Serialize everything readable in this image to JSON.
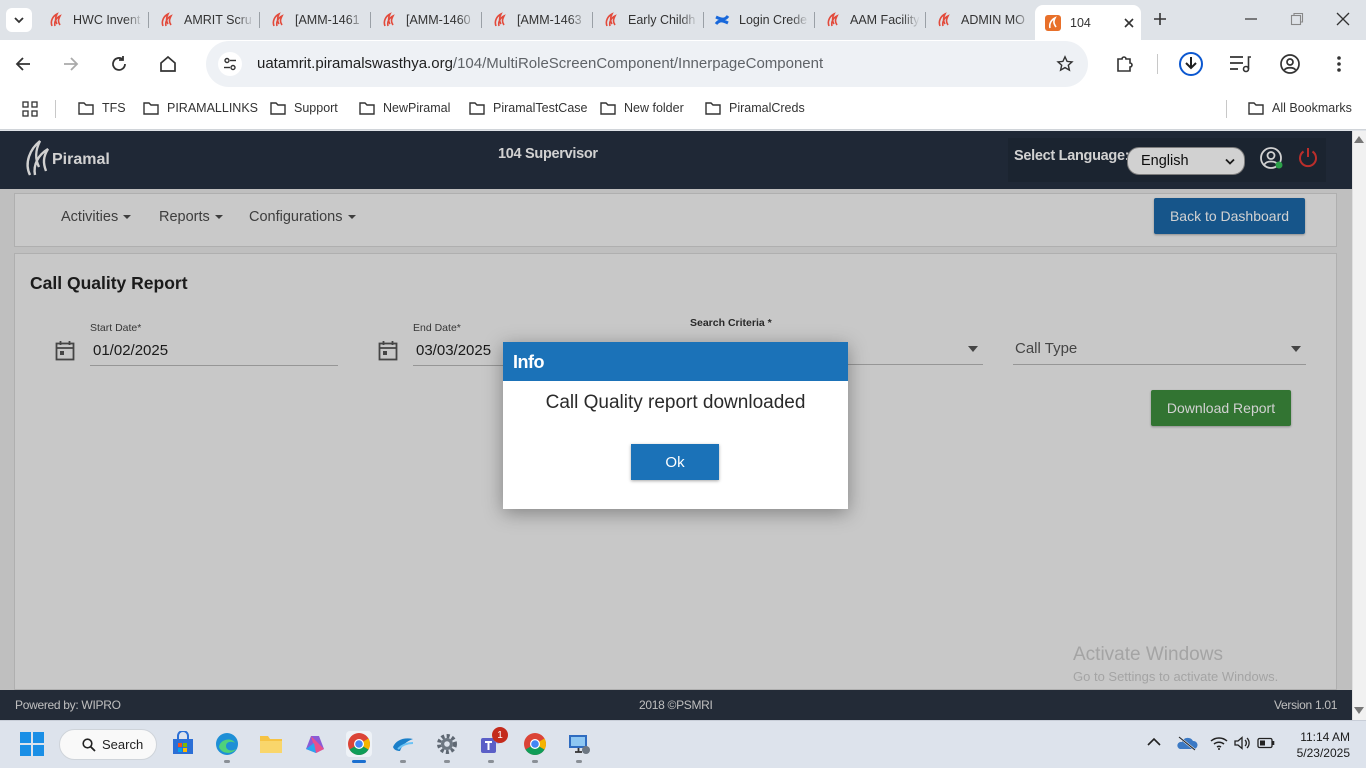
{
  "browser": {
    "tabs": [
      {
        "label": "HWC Invent"
      },
      {
        "label": "AMRIT Scru"
      },
      {
        "label": "[AMM-1461"
      },
      {
        "label": "[AMM-1460"
      },
      {
        "label": "[AMM-1463"
      },
      {
        "label": "Early Childh"
      },
      {
        "label": "Login Crede"
      },
      {
        "label": "AAM Facility"
      },
      {
        "label": "ADMIN MO"
      },
      {
        "label": "104"
      }
    ],
    "url_host": "uatamrit.piramalswasthya.org",
    "url_path": "/104/MultiRoleScreenComponent/InnerpageComponent",
    "bookmarks": [
      "TFS",
      "PIRAMALLINKS",
      "Support",
      "NewPiramal",
      "PiramalTestCase",
      "New folder",
      "PiramalCreds"
    ],
    "all_bookmarks": "All Bookmarks"
  },
  "app": {
    "logo_text": "Piramal",
    "header_title": "104 Supervisor",
    "language_label": "Select Language:",
    "language_value": "English",
    "nav": [
      "Activities",
      "Reports",
      "Configurations"
    ],
    "back_button": "Back to Dashboard",
    "report_title": "Call Quality Report",
    "start_date_label": "Start Date*",
    "start_date_value": "01/02/2025",
    "end_date_label": "End Date*",
    "end_date_value": "03/03/2025",
    "search_criteria_label": "Search Criteria *",
    "call_type_placeholder": "Call Type",
    "download_button": "Download Report",
    "footer_left": "Powered by: WIPRO",
    "footer_center": "2018 ©PSMRI",
    "footer_right": "Version 1.01"
  },
  "dialog": {
    "title": "Info",
    "message": "Call Quality report downloaded",
    "ok_button": "Ok"
  },
  "watermark": {
    "line1": "Activate Windows",
    "line2": "Go to Settings to activate Windows."
  },
  "taskbar": {
    "search_label": "Search",
    "teams_badge": "1",
    "time": "11:14 AM",
    "date": "5/23/2025"
  },
  "colors": {
    "app_header": "#263142",
    "primary_blue": "#1b72b8",
    "download_green": "#3e8e3e",
    "power_red": "#e53935"
  }
}
